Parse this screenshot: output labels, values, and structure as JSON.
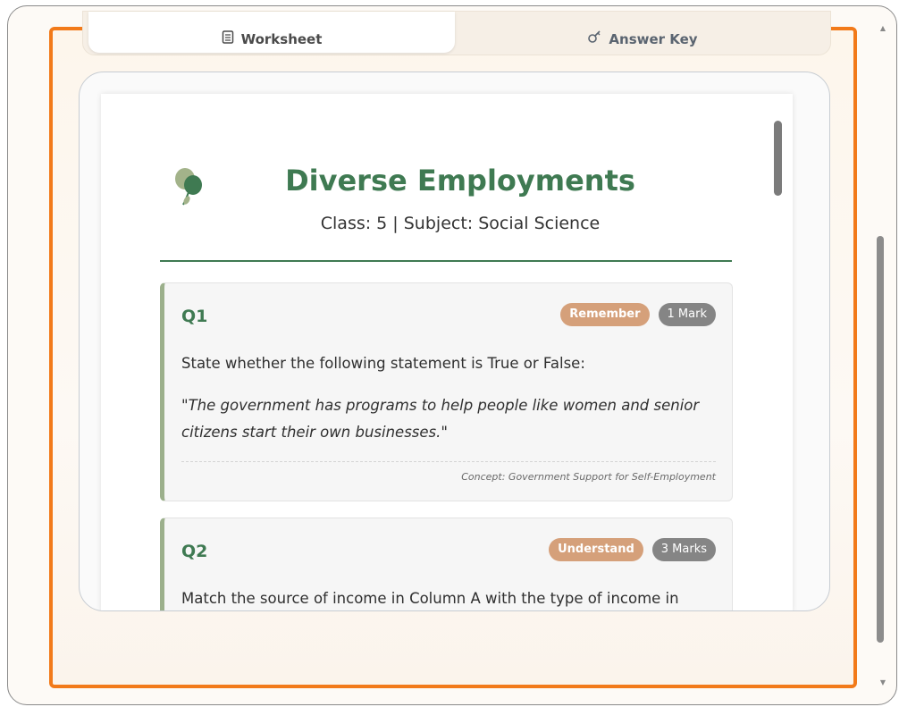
{
  "tabs": {
    "worksheet_label": "Worksheet",
    "answer_key_label": "Answer Key",
    "worksheet_icon": "document-icon",
    "answer_key_icon": "key-icon"
  },
  "document": {
    "title": "Diverse Employments",
    "subtitle": "Class: 5 | Subject: Social Science"
  },
  "questions": [
    {
      "number": "Q1",
      "bloom": "Remember",
      "marks": "1 Mark",
      "text": "State whether the following statement is True or False:",
      "quote": "\"The government has programs to help people like women and senior citizens start their own businesses.\"",
      "concept": "Concept: Government Support for Self-Employment"
    },
    {
      "number": "Q2",
      "bloom": "Understand",
      "marks": "3 Marks",
      "text": "Match the source of income in Column A with the type of income in"
    }
  ],
  "colors": {
    "accent": "#3f7a52",
    "frame_highlight": "#f27a1a",
    "bloom_badge": "#d5a07a",
    "marks_badge": "#858585"
  }
}
